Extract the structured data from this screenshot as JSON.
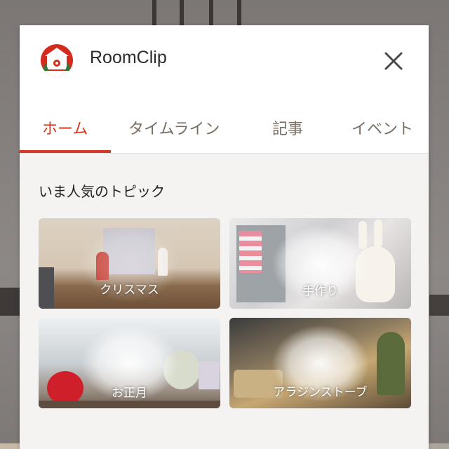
{
  "app": {
    "title": "RoomClip"
  },
  "tabs": [
    {
      "label": "ホーム",
      "active": true
    },
    {
      "label": "タイムライン",
      "active": false
    },
    {
      "label": "記事",
      "active": false
    },
    {
      "label": "イベント",
      "active": false
    }
  ],
  "section": {
    "title": "いま人気のトピック"
  },
  "topics": [
    {
      "label": "クリスマス"
    },
    {
      "label": "手作り"
    },
    {
      "label": "お正月"
    },
    {
      "label": "アラジンストーブ"
    }
  ],
  "colors": {
    "accent": "#d23a24",
    "logo_red": "#d42b1f",
    "tab_inactive": "#7a6e62"
  },
  "icons": {
    "close": "close-icon",
    "logo": "roomclip-logo"
  }
}
